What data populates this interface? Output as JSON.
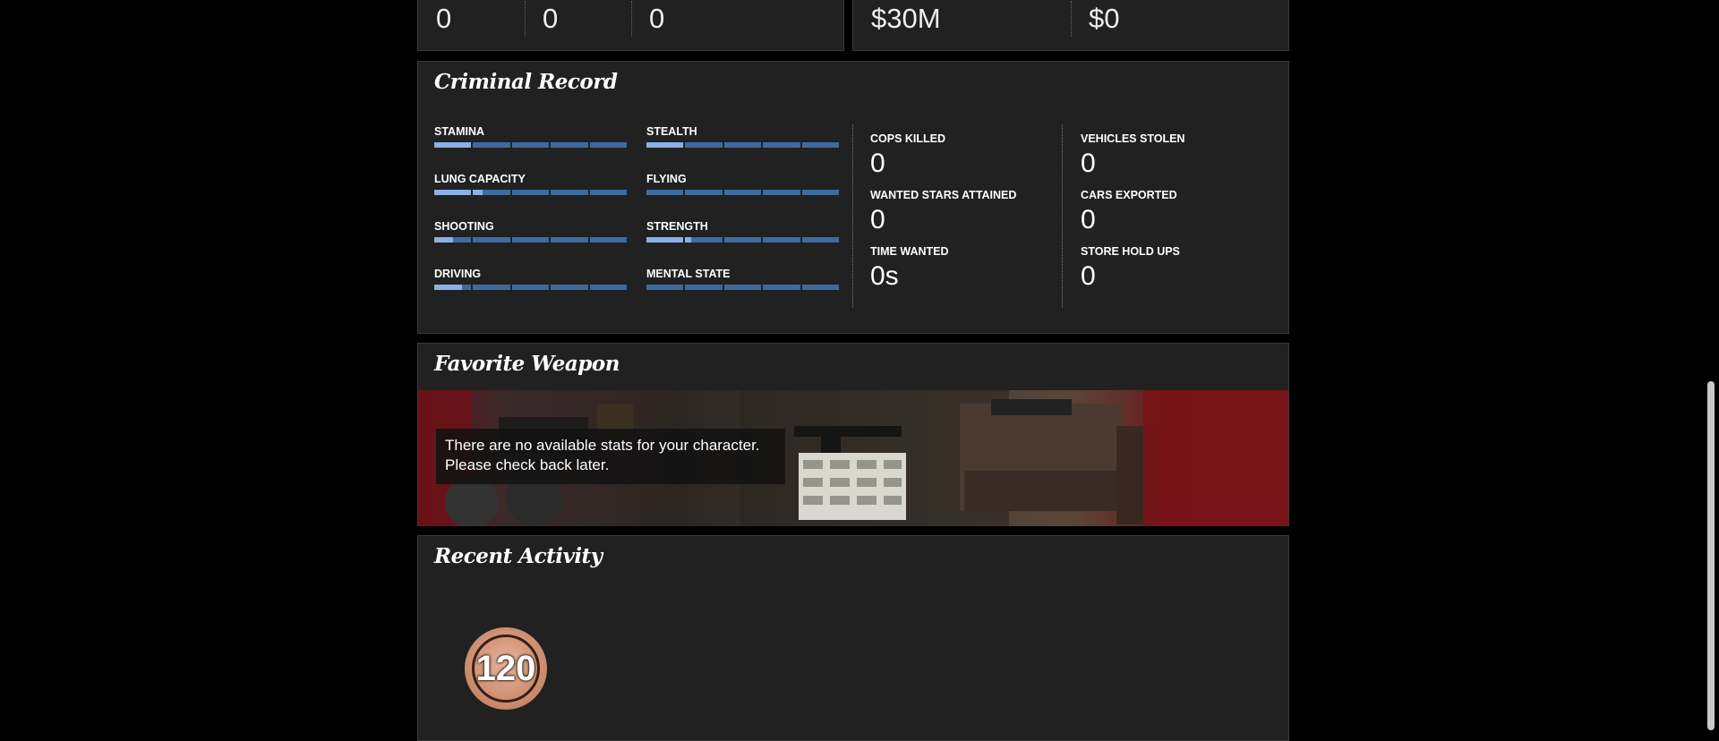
{
  "top_stats_left": [
    "0",
    "0",
    "0"
  ],
  "top_stats_right": [
    "$30M",
    "$0"
  ],
  "criminal_record": {
    "title": "Criminal Record",
    "skills": [
      {
        "label": "STAMINA",
        "level": 0.2
      },
      {
        "label": "STEALTH",
        "level": 0.2
      },
      {
        "label": "LUNG CAPACITY",
        "level": 0.25
      },
      {
        "label": "FLYING",
        "level": 0.0
      },
      {
        "label": "SHOOTING",
        "level": 0.1
      },
      {
        "label": "STRENGTH",
        "level": 0.23
      },
      {
        "label": "DRIVING",
        "level": 0.15
      },
      {
        "label": "MENTAL STATE",
        "level": 0.0
      }
    ],
    "stats_left": [
      {
        "label": "COPS KILLED",
        "value": "0"
      },
      {
        "label": "WANTED STARS ATTAINED",
        "value": "0"
      },
      {
        "label": "TIME WANTED",
        "value": "0s"
      }
    ],
    "stats_right": [
      {
        "label": "VEHICLES STOLEN",
        "value": "0"
      },
      {
        "label": "CARS EXPORTED",
        "value": "0"
      },
      {
        "label": "STORE HOLD UPS",
        "value": "0"
      }
    ]
  },
  "favorite_weapon": {
    "title": "Favorite Weapon",
    "message_line1": "There are no available stats for your character.",
    "message_line2": "Please check back later."
  },
  "recent_activity": {
    "title": "Recent Activity",
    "rank_badge": "120"
  }
}
